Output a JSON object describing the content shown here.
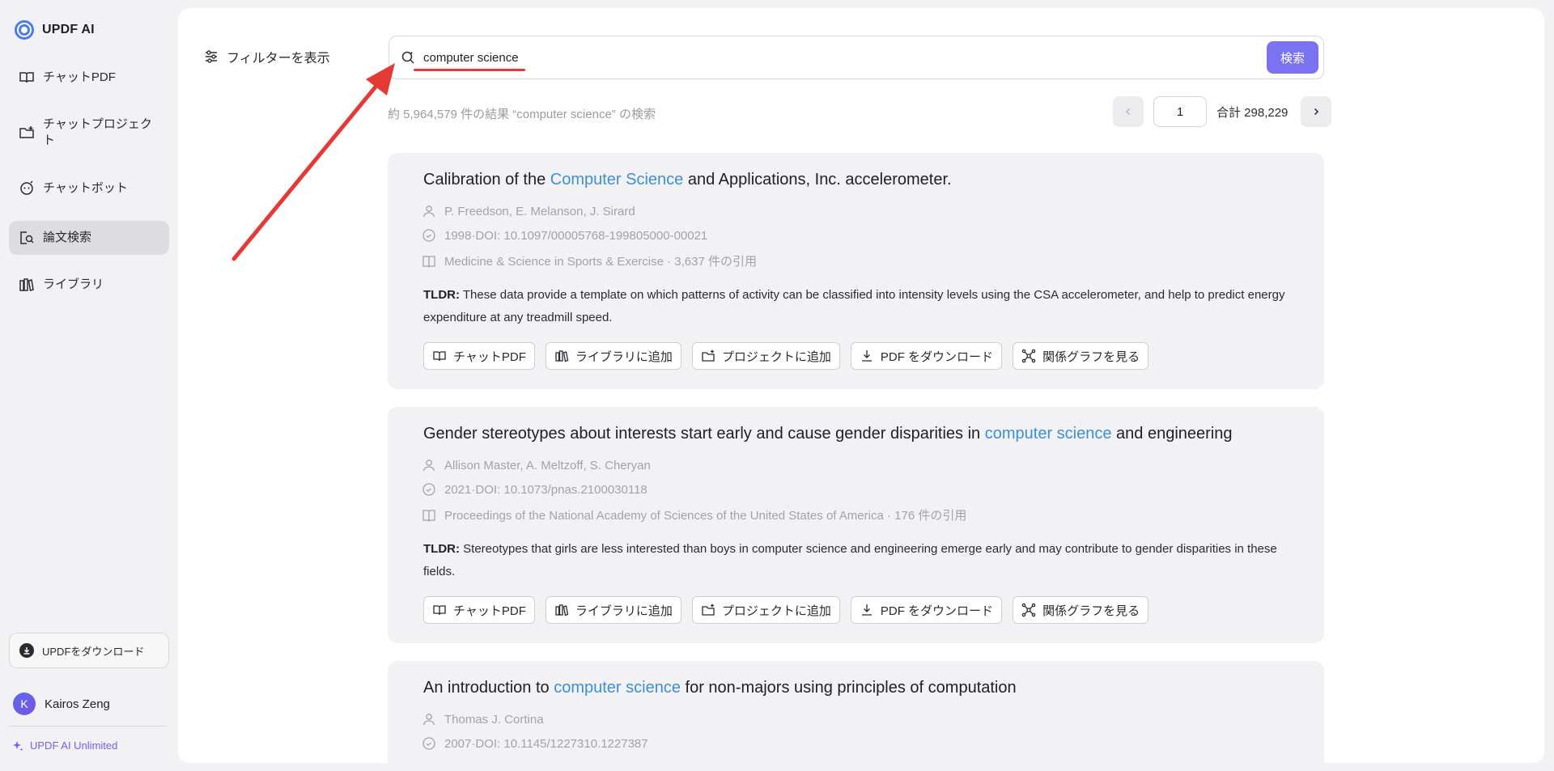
{
  "app": {
    "name": "UPDF AI"
  },
  "sidebar": {
    "items": [
      {
        "label": "チャットPDF",
        "icon": "book-open-icon"
      },
      {
        "label": "チャットプロジェクト",
        "icon": "folder-plus-icon"
      },
      {
        "label": "チャットボット",
        "icon": "chatbot-icon"
      },
      {
        "label": "論文検索",
        "icon": "paper-search-icon",
        "active": true
      },
      {
        "label": "ライブラリ",
        "icon": "library-icon"
      }
    ],
    "download_label": "UPDFをダウンロード",
    "user": {
      "initial": "K",
      "name": "Kairos Zeng"
    },
    "unlimited_label": "UPDF AI Unlimited"
  },
  "filter": {
    "label": "フィルターを表示"
  },
  "search": {
    "value": "computer science",
    "button": "検索"
  },
  "results": {
    "count_text": "約 5,964,579 件の結果 “computer science” の検索",
    "page": "1",
    "total_text": "合計 298,229"
  },
  "papers": [
    {
      "title_pre": "Calibration of the ",
      "title_hl": "Computer Science",
      "title_post": " and Applications, Inc. accelerometer.",
      "authors": "P. Freedson,  E. Melanson,  J. Sirard",
      "date_doi": "1998·DOI: 10.1097/00005768-199805000-00021",
      "venue": "Medicine & Science in Sports & Exercise · 3,637 件の引用",
      "tldr_label": "TLDR:",
      "tldr": " These data provide a template on which patterns of activity can be classified into intensity levels using the CSA accelerometer, and help to predict energy expenditure at any treadmill speed."
    },
    {
      "title_pre": "Gender stereotypes about interests start early and cause gender disparities in ",
      "title_hl": "computer science",
      "title_post": " and engineering",
      "authors": "Allison Master,  A. Meltzoff,  S. Cheryan",
      "date_doi": "2021·DOI: 10.1073/pnas.2100030118",
      "venue": "Proceedings of the National Academy of Sciences of the United States of America · 176 件の引用",
      "tldr_label": "TLDR:",
      "tldr": " Stereotypes that girls are less interested than boys in computer science and engineering emerge early and may contribute to gender disparities in these fields."
    },
    {
      "title_pre": "An introduction to ",
      "title_hl": "computer science",
      "title_post": " for non-majors using principles of computation",
      "authors": "Thomas J. Cortina",
      "date_doi": "2007·DOI: 10.1145/1227310.1227387"
    }
  ],
  "actions": {
    "chat_pdf": "チャットPDF",
    "add_library": "ライブラリに追加",
    "add_project": "プロジェクトに追加",
    "download_pdf": "PDF をダウンロード",
    "relation_graph": "関係グラフを見る"
  },
  "colors": {
    "accent": "#7b72f2",
    "highlight": "#3d8fd8",
    "annotation_red": "#e53935"
  }
}
